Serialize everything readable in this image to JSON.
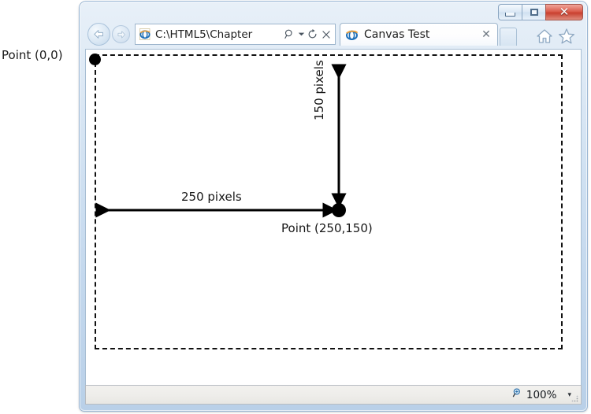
{
  "annotations": {
    "origin_label": "Point (0,0)",
    "endpoint_label": "Point (250,150)",
    "horizontal_measure": "250 pixels",
    "vertical_measure": "150 pixels"
  },
  "browser": {
    "window_controls": {
      "minimize": "Minimize",
      "maximize": "Maximize",
      "close": "✕"
    },
    "nav": {
      "back": "Back",
      "forward": "Forward"
    },
    "address": {
      "value": "C:\\HTML5\\Chapter",
      "placeholder": "C:\\HTML5\\Chapter",
      "search_icon": "search-icon",
      "caret_icon": "chevron-down-icon",
      "refresh_icon": "refresh-icon",
      "stop_icon": "stop-icon"
    },
    "tabs": [
      {
        "label": "Canvas Test",
        "favicon": "ie-logo-icon",
        "close": "✕"
      }
    ],
    "new_tab_label": "",
    "toolbar_right": {
      "home": "home-icon",
      "favorites": "favorites-star-icon"
    },
    "status_bar": {
      "zoom_icon": "zoom-magnifier-icon",
      "zoom_level": "100%",
      "zoom_caret": "▾"
    }
  },
  "colors": {
    "accent": "#c8402f",
    "frame": "#c5d9ee",
    "canvas_stroke": "#111111",
    "page_background": "#ffffff"
  }
}
